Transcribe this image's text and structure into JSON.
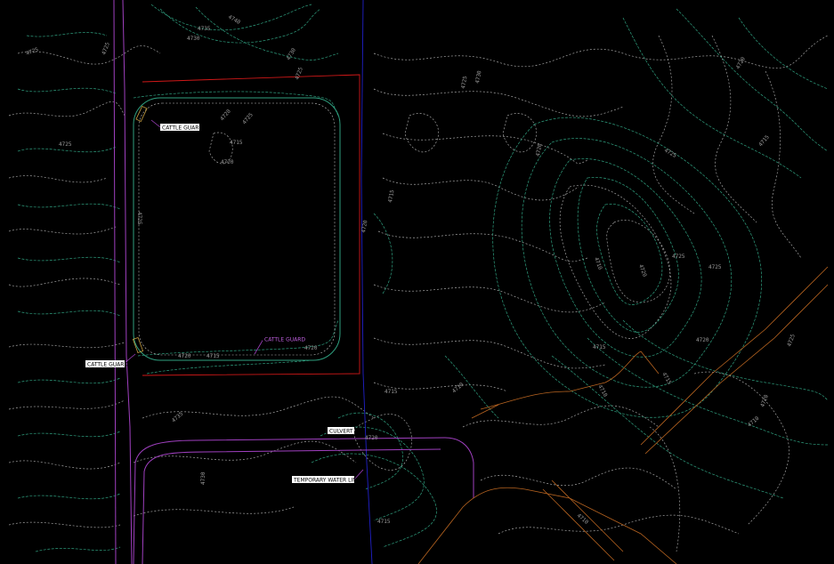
{
  "colors": {
    "background": "#000000",
    "contour_white": "#bfbfbf",
    "contour_green": "#2f9f7f",
    "boundary_red": "#d01818",
    "road_purple": "#a040c0",
    "line_blue": "#2020c8",
    "pipe_orange": "#b86420"
  },
  "callouts": {
    "cattle_guard_1": "CATTLE GUARD",
    "cattle_guard_2": "CATTLE GUARD",
    "cattle_guard_3": "CATTLE GUARD",
    "culvert": "CULVERT",
    "temp_water_line": "TEMPORARY WATER LINE"
  },
  "contour_labels": {
    "c1": "4725",
    "c2": "4730",
    "c3": "4735",
    "c4": "4740",
    "c5": "4725",
    "c6": "4730",
    "c7": "4725",
    "c8": "4725",
    "c9": "4720",
    "c10": "4725",
    "c11": "4715",
    "c12": "4720",
    "c13": "4725",
    "c14": "4720",
    "c15": "4715",
    "c16": "4720",
    "c17": "4715",
    "c18": "4710",
    "c19": "4715",
    "c20": "4720",
    "c21": "4725",
    "c22": "4730",
    "c23": "4720",
    "c24": "4725",
    "c25": "4720",
    "c26": "4715",
    "c27": "4710",
    "c28": "4720",
    "c29": "4725",
    "c30": "4725",
    "c31": "4720",
    "c32": "4715",
    "c33": "4710",
    "c34": "4715",
    "c35": "4720",
    "c36": "4710",
    "c37": "4725",
    "c38": "4735",
    "c39": "4730",
    "c40": "4720",
    "c41": "4715",
    "c42": "4710"
  }
}
